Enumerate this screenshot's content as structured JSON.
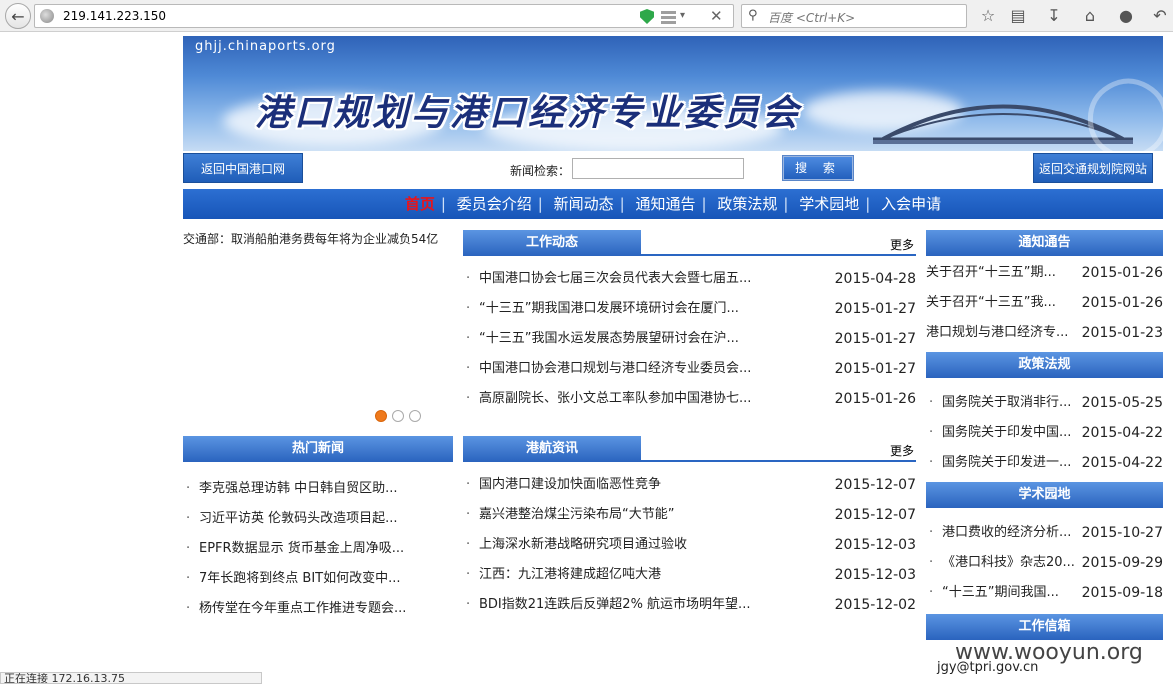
{
  "browser": {
    "url": "219.141.223.150",
    "search_placeholder": "百度 <Ctrl+K>",
    "status": "正在连接 172.16.13.75"
  },
  "site": {
    "domain": "ghjj.chinaports.org",
    "title": "港口规划与港口经济专业委员会",
    "back_ports": "返回中国港口网",
    "back_traffic": "返回交通规划院网站",
    "search_label": "新闻检索：",
    "search_button": "搜 索",
    "nav": [
      {
        "label": "首页"
      },
      {
        "label": "委员会介绍"
      },
      {
        "label": "新闻动态"
      },
      {
        "label": "通知通告"
      },
      {
        "label": "政策法规"
      },
      {
        "label": "学术园地"
      },
      {
        "label": "入会申请"
      }
    ],
    "ticker": "交通部：取消船舶港务费每年将为企业减负54亿"
  },
  "work_news": {
    "title": "工作动态",
    "more": "更多",
    "items": [
      {
        "title": "中国港口协会七届三次会员代表大会暨七届五...",
        "date": "2015-04-28"
      },
      {
        "title": "“十三五”期我国港口发展环境研讨会在厦门...",
        "date": "2015-01-27"
      },
      {
        "title": "“十三五”我国水运发展态势展望研讨会在沪...",
        "date": "2015-01-27"
      },
      {
        "title": "中国港口协会港口规划与港口经济专业委员会...",
        "date": "2015-01-27"
      },
      {
        "title": "高原副院长、张小文总工率队参加中国港协七...",
        "date": "2015-01-26"
      }
    ]
  },
  "hot_news": {
    "title": "热门新闻",
    "items": [
      {
        "title": "李克强总理访韩 中日韩自贸区助..."
      },
      {
        "title": "习近平访英 伦敦码头改造项目起..."
      },
      {
        "title": "EPFR数据显示 货币基金上周净吸..."
      },
      {
        "title": "7年长跑将到终点 BIT如何改变中..."
      },
      {
        "title": "杨传堂在今年重点工作推进专题会..."
      }
    ]
  },
  "port_news": {
    "title": "港航资讯",
    "more": "更多",
    "items": [
      {
        "title": "国内港口建设加快面临恶性竞争",
        "date": "2015-12-07"
      },
      {
        "title": "嘉兴港整治煤尘污染布局“大节能”",
        "date": "2015-12-07"
      },
      {
        "title": "上海深水新港战略研究项目通过验收",
        "date": "2015-12-03"
      },
      {
        "title": "江西：九江港将建成超亿吨大港",
        "date": "2015-12-03"
      },
      {
        "title": "BDI指数21连跌后反弹超2% 航运市场明年望...",
        "date": "2015-12-02"
      }
    ]
  },
  "notices": {
    "title": "通知通告",
    "items": [
      {
        "title": "关于召开“十三五”期...",
        "date": "2015-01-26"
      },
      {
        "title": "关于召开“十三五”我...",
        "date": "2015-01-26"
      },
      {
        "title": "港口规划与港口经济专...",
        "date": "2015-01-23"
      }
    ]
  },
  "policy": {
    "title": "政策法规",
    "items": [
      {
        "title": "国务院关于取消非行...",
        "date": "2015-05-25"
      },
      {
        "title": "国务院关于印发中国...",
        "date": "2015-04-22"
      },
      {
        "title": "国务院关于印发进一...",
        "date": "2015-04-22"
      }
    ]
  },
  "academic": {
    "title": "学术园地",
    "items": [
      {
        "title": "港口费收的经济分析...",
        "date": "2015-10-27"
      },
      {
        "title": "《港口科技》杂志20...",
        "date": "2015-09-29"
      },
      {
        "title": "“十三五”期间我国...",
        "date": "2015-09-18"
      }
    ]
  },
  "work_mailbox": {
    "title": "工作信箱"
  },
  "footer": {
    "watermark": "www.wooyun.org",
    "email": "jgy@tpri.gov.cn"
  }
}
